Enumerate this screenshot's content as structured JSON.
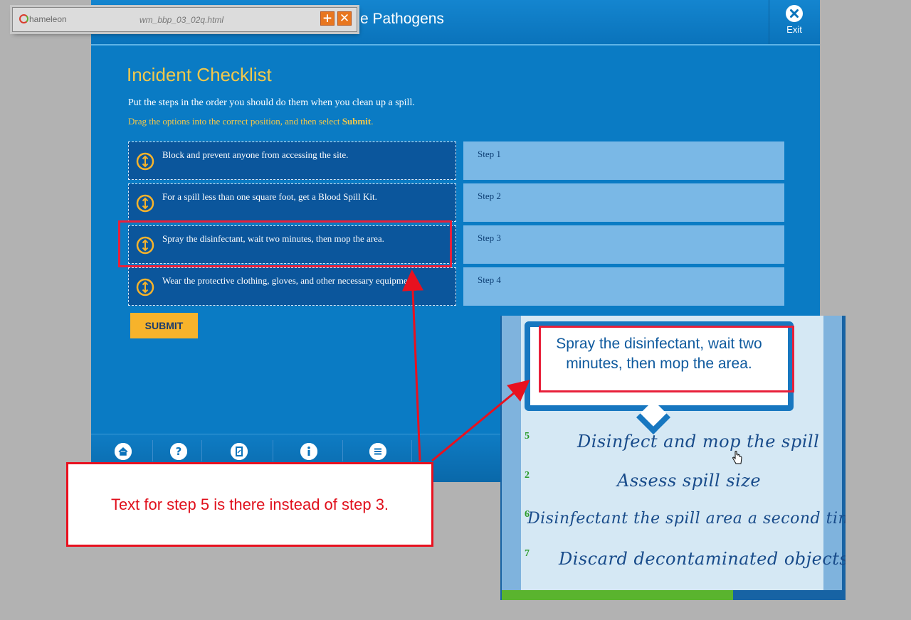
{
  "course": {
    "title": "e Pathogens",
    "exit_label": "Exit",
    "page_title": "Incident Checklist",
    "instruction": "Put the steps in the order you should do them when you clean up a spill.",
    "hint_prefix": "Drag the options into the correct position, and then select ",
    "hint_bold": "Submit",
    "hint_suffix": ".",
    "options": [
      "Block and prevent anyone from accessing the site.",
      "For a spill less than one square foot, get a Blood Spill Kit.",
      "Spray the disinfectant, wait two minutes, then mop the area.",
      "Wear the protective clothing, gloves, and other necessary equipment."
    ],
    "steps": [
      "Step 1",
      "Step 2",
      "Step 3",
      "Step 4"
    ],
    "submit_label": "SUBMIT",
    "footer_icons": [
      "home-icon",
      "help-icon",
      "glossary-icon",
      "info-icon",
      "menu-icon"
    ]
  },
  "tool": {
    "logo": "hameleon",
    "filename": "wm_bbp_03_02q.html",
    "buttons": [
      "+",
      "✕"
    ],
    "accent": "#e8761f"
  },
  "callout": {
    "text": "Text for step 5 is there instead of step 3."
  },
  "inset": {
    "bubble_text": "Spray the disinfectant, wait two minutes, then mop the area.",
    "items": [
      {
        "num": "5",
        "text": "Disinfect and mop the spill"
      },
      {
        "num": "2",
        "text": "Assess spill size"
      },
      {
        "num": "6",
        "text": "Disinfectant the spill area a second time"
      },
      {
        "num": "7",
        "text": "Discard decontaminated objects"
      }
    ],
    "progress_fraction": 0.67
  },
  "colors": {
    "course_blue": "#0a7bc4",
    "option_blue": "#0b569c",
    "slot_blue": "#7ab8e6",
    "title_gold": "#f2c84b",
    "submit_gold": "#f7b32b",
    "annotation_red": "#e8111f"
  }
}
